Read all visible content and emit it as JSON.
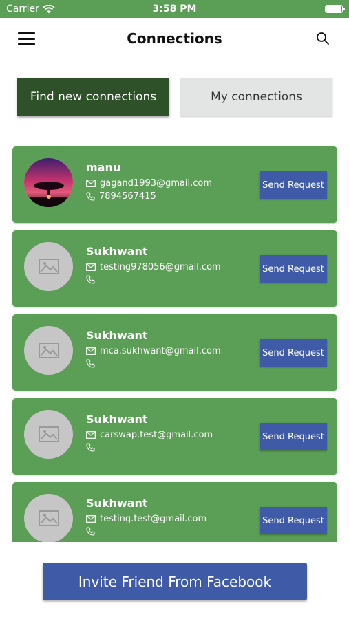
{
  "status_bar": {
    "carrier": "Carrier",
    "time": "3:58 PM",
    "battery_icon": "battery-full-icon",
    "wifi_icon": "wifi-icon"
  },
  "header": {
    "title": "Connections",
    "menu_icon": "hamburger-menu-icon",
    "search_icon": "search-icon"
  },
  "tabs": [
    {
      "label": "Find new connections",
      "active": true
    },
    {
      "label": "My connections",
      "active": false
    }
  ],
  "connections": [
    {
      "name": "manu",
      "email": "gagand1993@gmail.com",
      "phone": "7894567415",
      "has_photo": true,
      "action": "Send Request"
    },
    {
      "name": "Sukhwant",
      "email": "testing978056@gmail.com",
      "phone": "",
      "has_photo": false,
      "action": "Send Request"
    },
    {
      "name": "Sukhwant",
      "email": "mca.sukhwant@gmail.com",
      "phone": "",
      "has_photo": false,
      "action": "Send Request"
    },
    {
      "name": "Sukhwant",
      "email": "carswap.test@gmail.com",
      "phone": "",
      "has_photo": false,
      "action": "Send Request"
    },
    {
      "name": "Sukhwant",
      "email": "testing.test@gmail.com",
      "phone": "",
      "has_photo": false,
      "action": "Send Request"
    }
  ],
  "footer": {
    "invite_label": "Invite Friend From Facebook"
  },
  "colors": {
    "primary_green": "#5b9e56",
    "dark_green": "#2e5129",
    "button_blue": "#3f5aa6",
    "tab_gray": "#e3e5e4"
  }
}
